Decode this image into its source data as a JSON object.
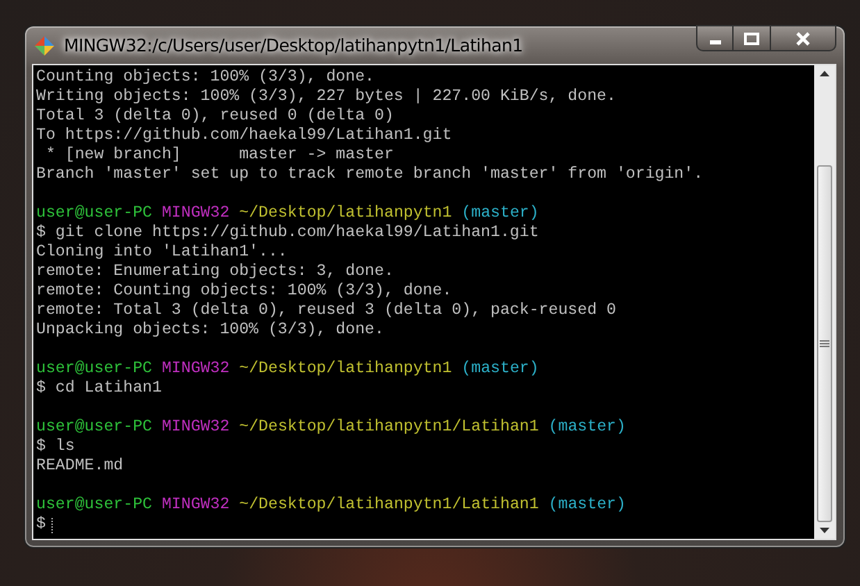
{
  "window": {
    "title": "MINGW32:/c/Users/user/Desktop/latihanpytn1/Latihan1"
  },
  "terminal": {
    "lines": [
      {
        "kind": "output",
        "text": "Counting objects: 100% (3/3), done."
      },
      {
        "kind": "output",
        "text": "Writing objects: 100% (3/3), 227 bytes | 227.00 KiB/s, done."
      },
      {
        "kind": "output",
        "text": "Total 3 (delta 0), reused 0 (delta 0)"
      },
      {
        "kind": "output",
        "text": "To https://github.com/haekal99/Latihan1.git"
      },
      {
        "kind": "output",
        "text": " * [new branch]      master -> master"
      },
      {
        "kind": "output",
        "text": "Branch 'master' set up to track remote branch 'master' from 'origin'."
      },
      {
        "kind": "blank"
      },
      {
        "kind": "prompt",
        "user": "user@user-PC",
        "host": "MINGW32",
        "path": "~/Desktop/latihanpytn1",
        "branch": "(master)"
      },
      {
        "kind": "output",
        "text": "$ git clone https://github.com/haekal99/Latihan1.git"
      },
      {
        "kind": "output",
        "text": "Cloning into 'Latihan1'..."
      },
      {
        "kind": "output",
        "text": "remote: Enumerating objects: 3, done."
      },
      {
        "kind": "output",
        "text": "remote: Counting objects: 100% (3/3), done."
      },
      {
        "kind": "output",
        "text": "remote: Total 3 (delta 0), reused 3 (delta 0), pack-reused 0"
      },
      {
        "kind": "output",
        "text": "Unpacking objects: 100% (3/3), done."
      },
      {
        "kind": "blank"
      },
      {
        "kind": "prompt",
        "user": "user@user-PC",
        "host": "MINGW32",
        "path": "~/Desktop/latihanpytn1",
        "branch": "(master)"
      },
      {
        "kind": "output",
        "text": "$ cd Latihan1"
      },
      {
        "kind": "blank"
      },
      {
        "kind": "prompt",
        "user": "user@user-PC",
        "host": "MINGW32",
        "path": "~/Desktop/latihanpytn1/Latihan1",
        "branch": "(master)"
      },
      {
        "kind": "output",
        "text": "$ ls"
      },
      {
        "kind": "output",
        "text": "README.md"
      },
      {
        "kind": "blank"
      },
      {
        "kind": "prompt",
        "user": "user@user-PC",
        "host": "MINGW32",
        "path": "~/Desktop/latihanpytn1/Latihan1",
        "branch": "(master)"
      },
      {
        "kind": "input",
        "text": "$"
      }
    ]
  }
}
